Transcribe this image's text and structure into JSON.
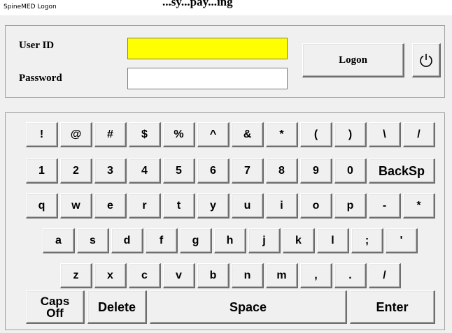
{
  "window": {
    "title": "SpineMED Logon",
    "ghost_title": "...sy...pay...ing"
  },
  "login": {
    "user_id_label": "User ID",
    "password_label": "Password",
    "user_id_value": "",
    "password_value": "",
    "user_id_bg": "#ffff00",
    "logon_label": "Logon",
    "power_icon": "power-icon"
  },
  "keyboard": {
    "row1": [
      "!",
      "@",
      "#",
      "$",
      "%",
      "^",
      "&",
      "*",
      "(",
      ")",
      "\\",
      "/"
    ],
    "row2": [
      "1",
      "2",
      "3",
      "4",
      "5",
      "6",
      "7",
      "8",
      "9",
      "0",
      "BackSp"
    ],
    "row3": [
      "q",
      "w",
      "e",
      "r",
      "t",
      "y",
      "u",
      "i",
      "o",
      "p",
      "-",
      "*"
    ],
    "row4": [
      "a",
      "s",
      "d",
      "f",
      "g",
      "h",
      "j",
      "k",
      "l",
      ";",
      "'"
    ],
    "row5": [
      "z",
      "x",
      "c",
      "v",
      "b",
      "n",
      "m",
      ",",
      ".",
      "/"
    ],
    "caps_line1": "Caps",
    "caps_line2": "Off",
    "delete_label": "Delete",
    "space_label": "Space",
    "enter_label": "Enter"
  }
}
